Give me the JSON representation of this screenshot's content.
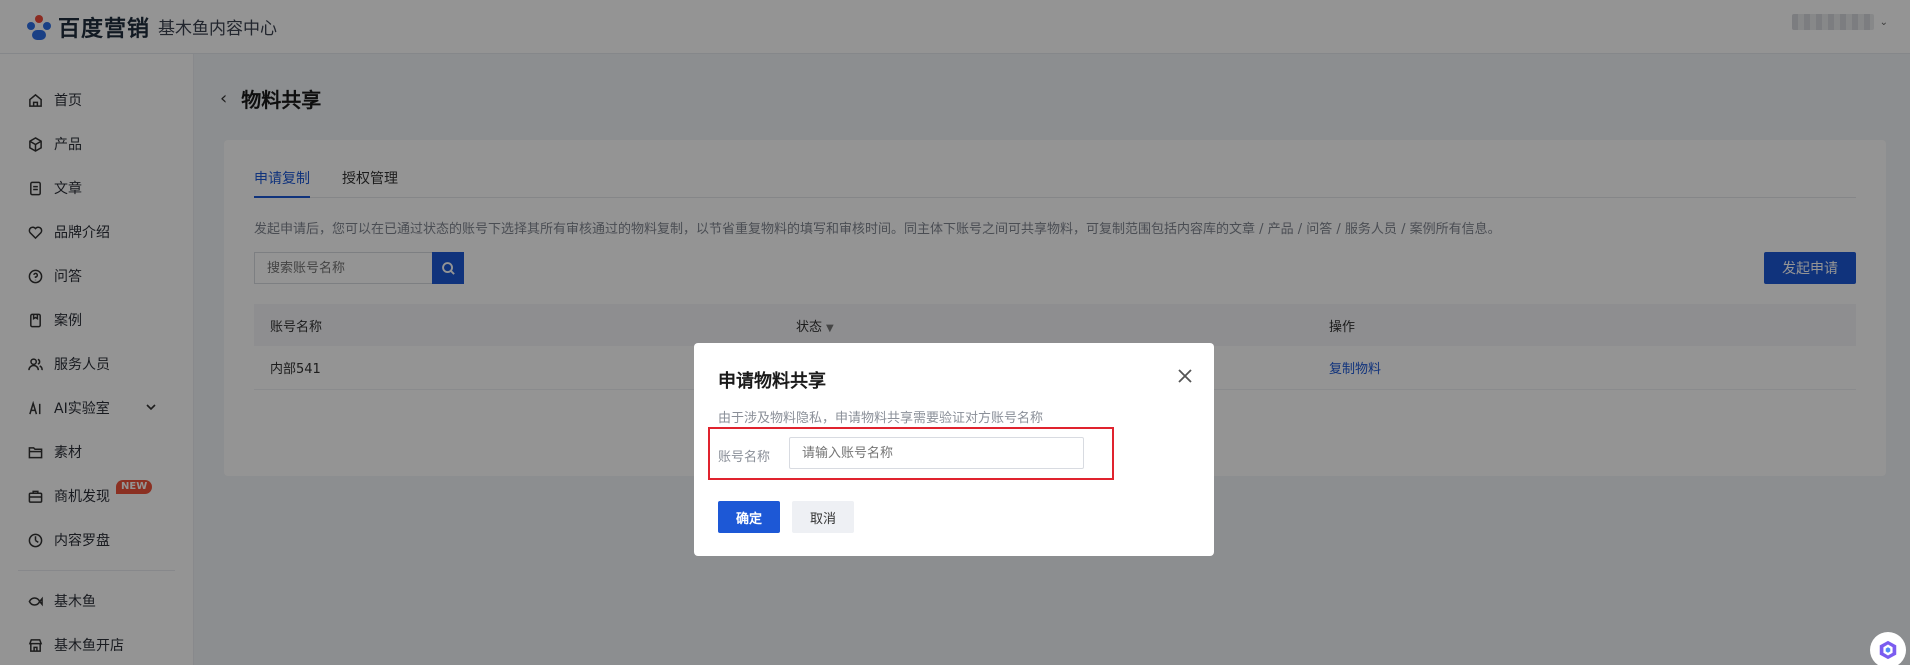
{
  "header": {
    "brand": "百度营销",
    "product": "基木鱼内容中心",
    "user_caret": "⌄"
  },
  "sidebar": {
    "items": [
      {
        "label": "首页",
        "icon": "home-icon"
      },
      {
        "label": "产品",
        "icon": "cube-icon"
      },
      {
        "label": "文章",
        "icon": "document-icon"
      },
      {
        "label": "品牌介绍",
        "icon": "heart-icon"
      },
      {
        "label": "问答",
        "icon": "question-icon"
      },
      {
        "label": "案例",
        "icon": "bookmark-icon"
      },
      {
        "label": "服务人员",
        "icon": "users-icon"
      },
      {
        "label": "AI实验室",
        "icon": "ai-icon"
      },
      {
        "label": "素材",
        "icon": "folder-icon"
      },
      {
        "label": "商机发现",
        "icon": "briefcase-icon",
        "badge": "NEW"
      },
      {
        "label": "内容罗盘",
        "icon": "compass-icon"
      }
    ],
    "bottom_items": [
      {
        "label": "基木鱼",
        "icon": "fish-icon"
      },
      {
        "label": "基木鱼开店",
        "icon": "shop-icon"
      }
    ]
  },
  "page": {
    "back_symbol": "‹",
    "title": "物料共享",
    "tabs": [
      {
        "label": "申请复制",
        "active": true
      },
      {
        "label": "授权管理",
        "active": false
      }
    ],
    "description": "发起申请后，您可以在已通过状态的账号下选择其所有审核通过的物料复制，以节省重复物料的填写和审核时间。同主体下账号之间可共享物料，可复制范围包括内容库的文章 / 产品 / 问答 / 服务人员 / 案例所有信息。",
    "search_placeholder": "搜索账号名称",
    "apply_button": "发起申请",
    "table": {
      "columns": [
        "账号名称",
        "状态",
        "操作"
      ],
      "rows": [
        {
          "account": "内部541",
          "status": "",
          "action": "复制物料"
        }
      ]
    }
  },
  "modal": {
    "title": "申请物料共享",
    "description": "由于涉及物料隐私，申请物料共享需要验证对方账号名称",
    "field_label": "账号名称",
    "field_placeholder": "请输入账号名称",
    "ok_button": "确定",
    "cancel_button": "取消"
  },
  "colors": {
    "primary": "#1d58d6",
    "highlight_border": "#e0232e",
    "badge": "#f0533c"
  }
}
